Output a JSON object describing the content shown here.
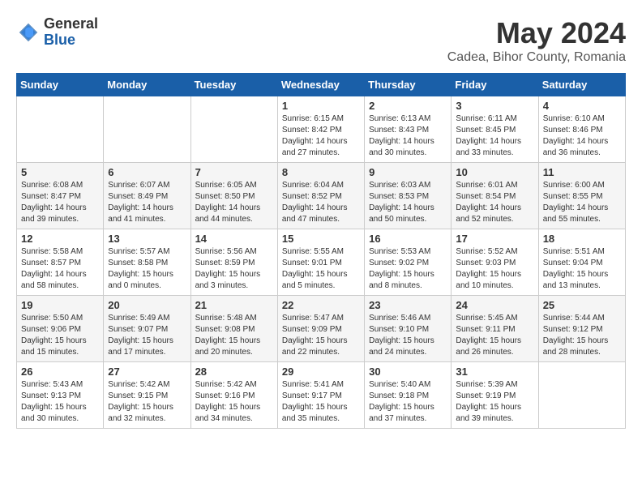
{
  "logo": {
    "general": "General",
    "blue": "Blue"
  },
  "title": "May 2024",
  "location": "Cadea, Bihor County, Romania",
  "weekdays": [
    "Sunday",
    "Monday",
    "Tuesday",
    "Wednesday",
    "Thursday",
    "Friday",
    "Saturday"
  ],
  "weeks": [
    [
      {
        "day": "",
        "info": ""
      },
      {
        "day": "",
        "info": ""
      },
      {
        "day": "",
        "info": ""
      },
      {
        "day": "1",
        "info": "Sunrise: 6:15 AM\nSunset: 8:42 PM\nDaylight: 14 hours\nand 27 minutes."
      },
      {
        "day": "2",
        "info": "Sunrise: 6:13 AM\nSunset: 8:43 PM\nDaylight: 14 hours\nand 30 minutes."
      },
      {
        "day": "3",
        "info": "Sunrise: 6:11 AM\nSunset: 8:45 PM\nDaylight: 14 hours\nand 33 minutes."
      },
      {
        "day": "4",
        "info": "Sunrise: 6:10 AM\nSunset: 8:46 PM\nDaylight: 14 hours\nand 36 minutes."
      }
    ],
    [
      {
        "day": "5",
        "info": "Sunrise: 6:08 AM\nSunset: 8:47 PM\nDaylight: 14 hours\nand 39 minutes."
      },
      {
        "day": "6",
        "info": "Sunrise: 6:07 AM\nSunset: 8:49 PM\nDaylight: 14 hours\nand 41 minutes."
      },
      {
        "day": "7",
        "info": "Sunrise: 6:05 AM\nSunset: 8:50 PM\nDaylight: 14 hours\nand 44 minutes."
      },
      {
        "day": "8",
        "info": "Sunrise: 6:04 AM\nSunset: 8:52 PM\nDaylight: 14 hours\nand 47 minutes."
      },
      {
        "day": "9",
        "info": "Sunrise: 6:03 AM\nSunset: 8:53 PM\nDaylight: 14 hours\nand 50 minutes."
      },
      {
        "day": "10",
        "info": "Sunrise: 6:01 AM\nSunset: 8:54 PM\nDaylight: 14 hours\nand 52 minutes."
      },
      {
        "day": "11",
        "info": "Sunrise: 6:00 AM\nSunset: 8:55 PM\nDaylight: 14 hours\nand 55 minutes."
      }
    ],
    [
      {
        "day": "12",
        "info": "Sunrise: 5:58 AM\nSunset: 8:57 PM\nDaylight: 14 hours\nand 58 minutes."
      },
      {
        "day": "13",
        "info": "Sunrise: 5:57 AM\nSunset: 8:58 PM\nDaylight: 15 hours\nand 0 minutes."
      },
      {
        "day": "14",
        "info": "Sunrise: 5:56 AM\nSunset: 8:59 PM\nDaylight: 15 hours\nand 3 minutes."
      },
      {
        "day": "15",
        "info": "Sunrise: 5:55 AM\nSunset: 9:01 PM\nDaylight: 15 hours\nand 5 minutes."
      },
      {
        "day": "16",
        "info": "Sunrise: 5:53 AM\nSunset: 9:02 PM\nDaylight: 15 hours\nand 8 minutes."
      },
      {
        "day": "17",
        "info": "Sunrise: 5:52 AM\nSunset: 9:03 PM\nDaylight: 15 hours\nand 10 minutes."
      },
      {
        "day": "18",
        "info": "Sunrise: 5:51 AM\nSunset: 9:04 PM\nDaylight: 15 hours\nand 13 minutes."
      }
    ],
    [
      {
        "day": "19",
        "info": "Sunrise: 5:50 AM\nSunset: 9:06 PM\nDaylight: 15 hours\nand 15 minutes."
      },
      {
        "day": "20",
        "info": "Sunrise: 5:49 AM\nSunset: 9:07 PM\nDaylight: 15 hours\nand 17 minutes."
      },
      {
        "day": "21",
        "info": "Sunrise: 5:48 AM\nSunset: 9:08 PM\nDaylight: 15 hours\nand 20 minutes."
      },
      {
        "day": "22",
        "info": "Sunrise: 5:47 AM\nSunset: 9:09 PM\nDaylight: 15 hours\nand 22 minutes."
      },
      {
        "day": "23",
        "info": "Sunrise: 5:46 AM\nSunset: 9:10 PM\nDaylight: 15 hours\nand 24 minutes."
      },
      {
        "day": "24",
        "info": "Sunrise: 5:45 AM\nSunset: 9:11 PM\nDaylight: 15 hours\nand 26 minutes."
      },
      {
        "day": "25",
        "info": "Sunrise: 5:44 AM\nSunset: 9:12 PM\nDaylight: 15 hours\nand 28 minutes."
      }
    ],
    [
      {
        "day": "26",
        "info": "Sunrise: 5:43 AM\nSunset: 9:13 PM\nDaylight: 15 hours\nand 30 minutes."
      },
      {
        "day": "27",
        "info": "Sunrise: 5:42 AM\nSunset: 9:15 PM\nDaylight: 15 hours\nand 32 minutes."
      },
      {
        "day": "28",
        "info": "Sunrise: 5:42 AM\nSunset: 9:16 PM\nDaylight: 15 hours\nand 34 minutes."
      },
      {
        "day": "29",
        "info": "Sunrise: 5:41 AM\nSunset: 9:17 PM\nDaylight: 15 hours\nand 35 minutes."
      },
      {
        "day": "30",
        "info": "Sunrise: 5:40 AM\nSunset: 9:18 PM\nDaylight: 15 hours\nand 37 minutes."
      },
      {
        "day": "31",
        "info": "Sunrise: 5:39 AM\nSunset: 9:19 PM\nDaylight: 15 hours\nand 39 minutes."
      },
      {
        "day": "",
        "info": ""
      }
    ]
  ]
}
